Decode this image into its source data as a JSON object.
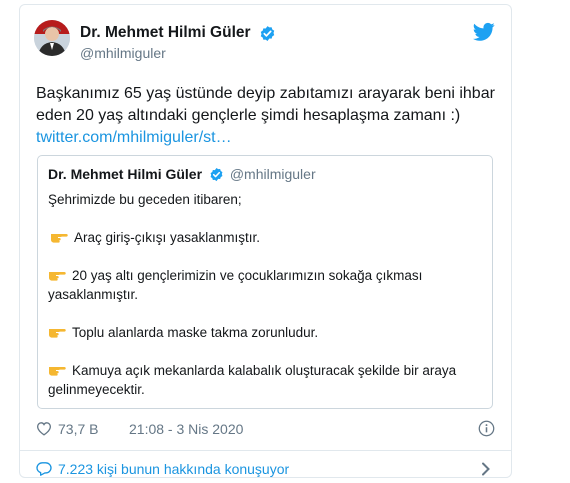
{
  "tweet": {
    "display_name": "Dr. Mehmet Hilmi Güler",
    "handle": "@mhilmiguler",
    "text": "Başkanımız 65 yaş üstünde deyip zabıtamızı arayarak beni ihbar eden 20 yaş altındaki gençlerle şimdi hesaplaşma zamanı :)",
    "link": "twitter.com/mhilmiguler/st…",
    "likes": "73,7 B",
    "timestamp": "21:08 - 3 Nis 2020",
    "conversation": "7.223 kişi bunun hakkında konuşuyor"
  },
  "quoted": {
    "display_name": "Dr. Mehmet Hilmi Güler",
    "handle": "@mhilmiguler",
    "intro": "Şehrimizde bu geceden itibaren;",
    "items": [
      "Araç giriş-çıkışı yasaklanmıştır.",
      "20 yaş altı gençlerimizin ve çocuklarımızın sokağa çıkması yasaklanmıştır.",
      "Toplu alanlarda maske takma zorunludur.",
      "Kamuya açık mekanlarda kalabalık oluşturacak şekilde bir araya gelinmeyecektir."
    ]
  },
  "colors": {
    "link": "#1b95e0",
    "text": "#14171a",
    "muted": "#657786",
    "verified": "#1da1f2",
    "border": "#e1e8ed"
  },
  "icons": [
    "verified-badge-icon",
    "twitter-bird-icon",
    "pointing-hand-emoji",
    "heart-icon",
    "info-icon",
    "comment-bubble-icon",
    "chevron-right-icon"
  ]
}
